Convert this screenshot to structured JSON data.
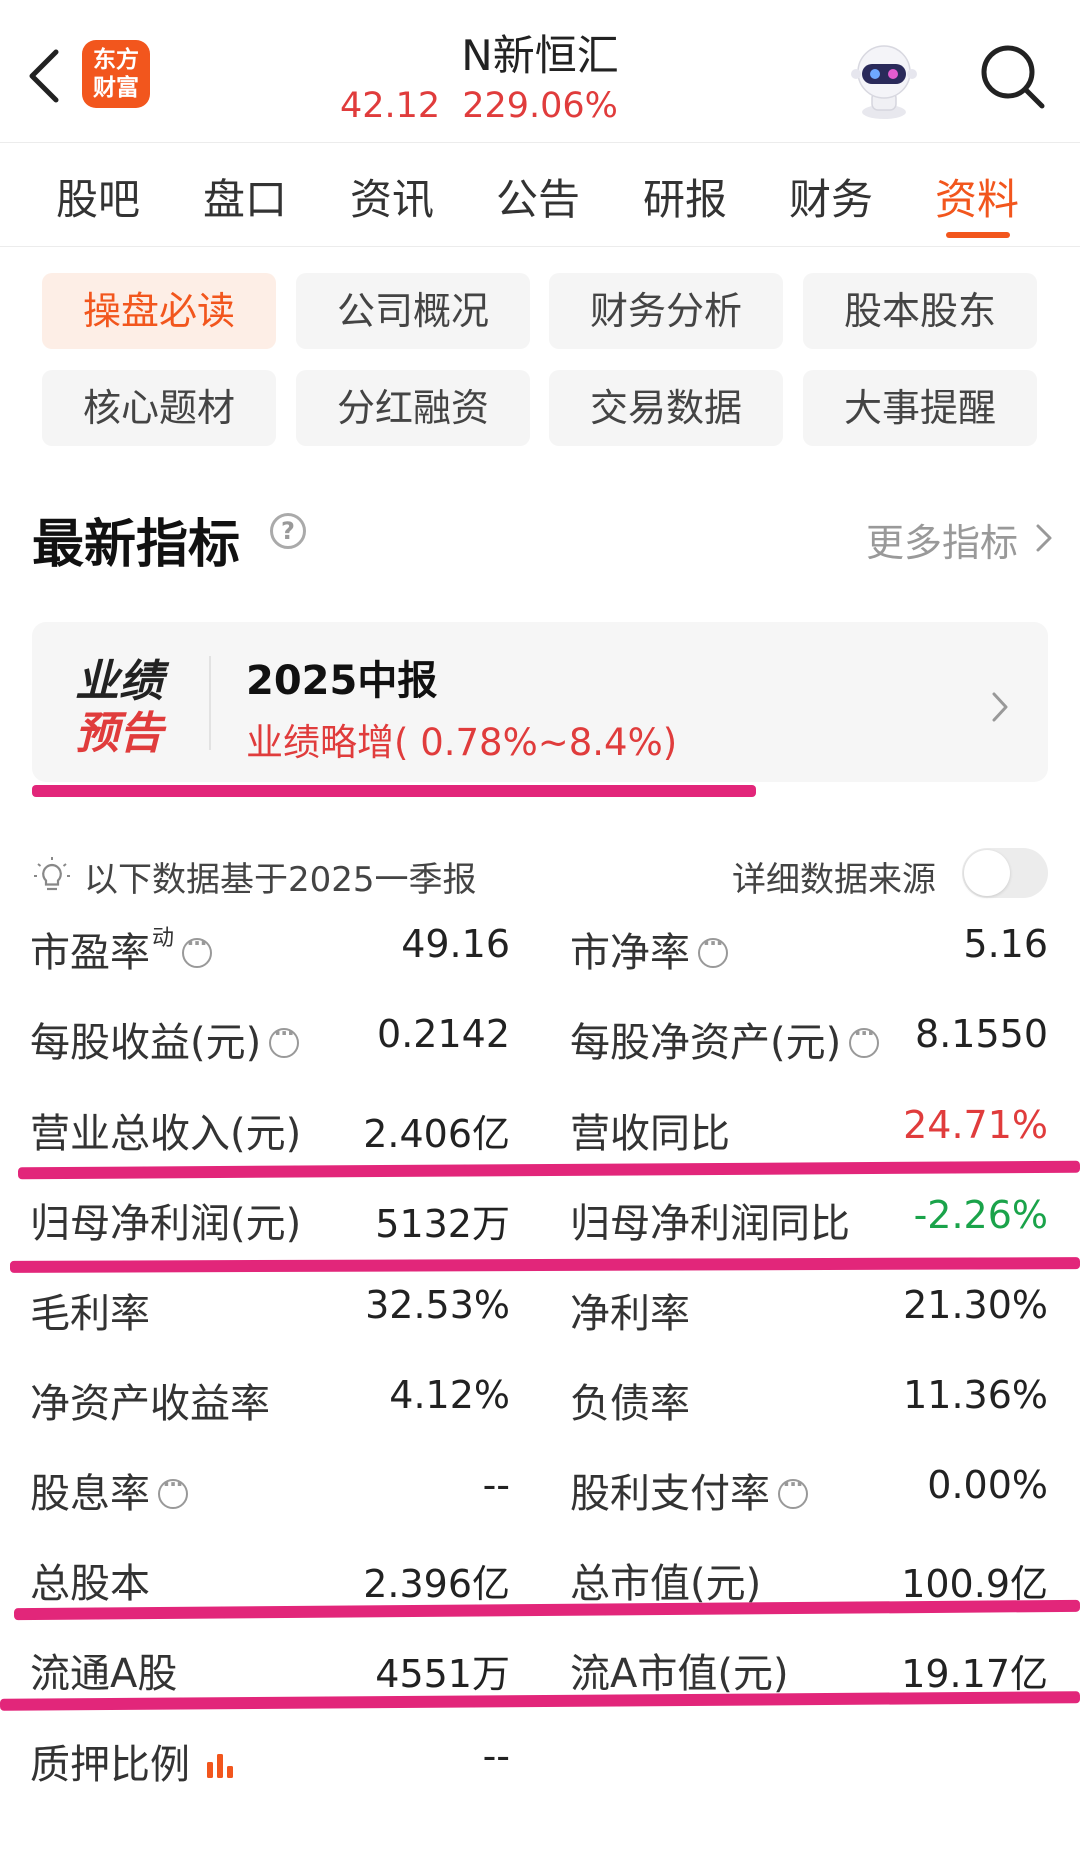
{
  "header": {
    "logo_line1": "东方",
    "logo_line2": "财富",
    "stock_name": "N新恒汇",
    "price": "42.12",
    "change_pct": "229.06%",
    "back_icon": "chevron-left-icon",
    "search_icon": "search-icon",
    "assistant_icon": "robot-assistant-icon"
  },
  "tabs": [
    {
      "label": "股吧"
    },
    {
      "label": "盘口"
    },
    {
      "label": "资讯"
    },
    {
      "label": "公告"
    },
    {
      "label": "研报"
    },
    {
      "label": "财务"
    },
    {
      "label": "资料",
      "active": true
    }
  ],
  "chips": [
    {
      "label": "操盘必读",
      "active": true
    },
    {
      "label": "公司概况"
    },
    {
      "label": "财务分析"
    },
    {
      "label": "股本股东"
    },
    {
      "label": "核心题材"
    },
    {
      "label": "分红融资"
    },
    {
      "label": "交易数据"
    },
    {
      "label": "大事提醒"
    }
  ],
  "section": {
    "title": "最新指标",
    "help_icon": "question-circle-icon",
    "more_label": "更多指标"
  },
  "forecast": {
    "badge_line1": "业绩",
    "badge_line2": "预告",
    "title": "2025中报",
    "subtitle": "业绩略增( 0.78%~8.4%)"
  },
  "data_basis": {
    "text": "以下数据基于2025一季报",
    "source_label": "详细数据来源",
    "source_toggle_on": false
  },
  "metrics": [
    {
      "left_label": "市盈率",
      "left_sup": "动",
      "left_info": true,
      "left_value": "49.16",
      "right_label": "市净率",
      "right_info": true,
      "right_value": "5.16"
    },
    {
      "left_label": "每股收益(元)",
      "left_info": true,
      "left_value": "0.2142",
      "right_label": "每股净资产(元)",
      "right_info": true,
      "right_value": "8.1550"
    },
    {
      "left_label": "营业总收入(元)",
      "left_value": "2.406亿",
      "right_label": "营收同比",
      "right_value": "24.71%",
      "right_color": "red"
    },
    {
      "left_label": "归母净利润(元)",
      "left_value": "5132万",
      "right_label": "归母净利润同比",
      "right_value": "-2.26%",
      "right_color": "green"
    },
    {
      "left_label": "毛利率",
      "left_value": "32.53%",
      "right_label": "净利率",
      "right_value": "21.30%"
    },
    {
      "left_label": "净资产收益率",
      "left_value": "4.12%",
      "right_label": "负债率",
      "right_value": "11.36%"
    },
    {
      "left_label": "股息率",
      "left_info": true,
      "left_value": "--",
      "right_label": "股利支付率",
      "right_info": true,
      "right_value": "0.00%"
    },
    {
      "left_label": "总股本",
      "left_value": "2.396亿",
      "right_label": "总市值(元)",
      "right_value": "100.9亿"
    },
    {
      "left_label": "流通A股",
      "left_value": "4551万",
      "right_label": "流A市值(元)",
      "right_value": "19.17亿"
    },
    {
      "left_label": "质押比例",
      "left_chart_icon": true,
      "left_value": "--"
    }
  ],
  "colors": {
    "accent": "#f2561d",
    "up": "#e03c3c",
    "down": "#1aa34a",
    "highlight_mark": "#e2267a"
  }
}
